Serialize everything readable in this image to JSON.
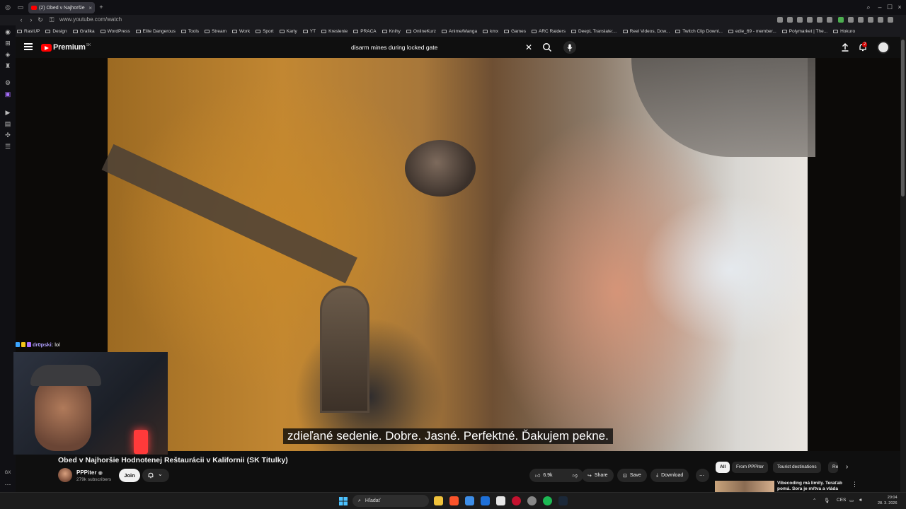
{
  "browser": {
    "tab_title": "(2) Obed v Najhoršie",
    "url": "www.youtube.com/watch",
    "bookmarks": [
      "RastUP",
      "Design",
      "Grafika",
      "WordPress",
      "Elite Dangerous",
      "Tools",
      "Stream",
      "Work",
      "Sport",
      "Karty",
      "YT",
      "Kreslenie",
      "PRACA",
      "Knihy",
      "OnlineKurz",
      "Anime/Manga",
      "kmx",
      "Games",
      "ARC Raiders",
      "DeepL Translate:...",
      "Reel Videos, Dow...",
      "Twitch Clip Downl...",
      "edie_69 - member...",
      "Polymarket | The...",
      "Hokuro"
    ]
  },
  "youtube": {
    "logo_text": "Premium",
    "logo_region": "SK",
    "search_value": "disarm mines during locked gate",
    "notification_count": "2",
    "subtitle": "zdieľané sedenie. Dobre. Jasné. Perfektné. Ďakujem pekne.",
    "video_title": "Obed v Najhoršie Hodnotenej Reštaurácii v Kalifornii (SK Titulky)",
    "channel": {
      "name": "PPPiter",
      "subscribers": "279k subscribers"
    },
    "join_label": "Join",
    "like_count": "6.9k",
    "share_label": "Share",
    "save_label": "Save",
    "download_label": "Download",
    "chips": [
      "All",
      "From PPPiter",
      "Tourist destinations",
      "Re"
    ],
    "recommendation_title": "Vibecoding má limity. Teraťab pomá. Sora je mŕtva a vláda"
  },
  "stream_overlay": {
    "chat_user": "dr0pski:",
    "chat_message": "lol"
  },
  "taskbar": {
    "search_label": "Hľadať",
    "language": "CES",
    "time": "20:04",
    "date": "28. 3. 2026"
  },
  "sidebar_label": "GX",
  "colors": {
    "accent": "#ff0000",
    "background": "#0f0f0f",
    "chip_bg": "#272727"
  }
}
